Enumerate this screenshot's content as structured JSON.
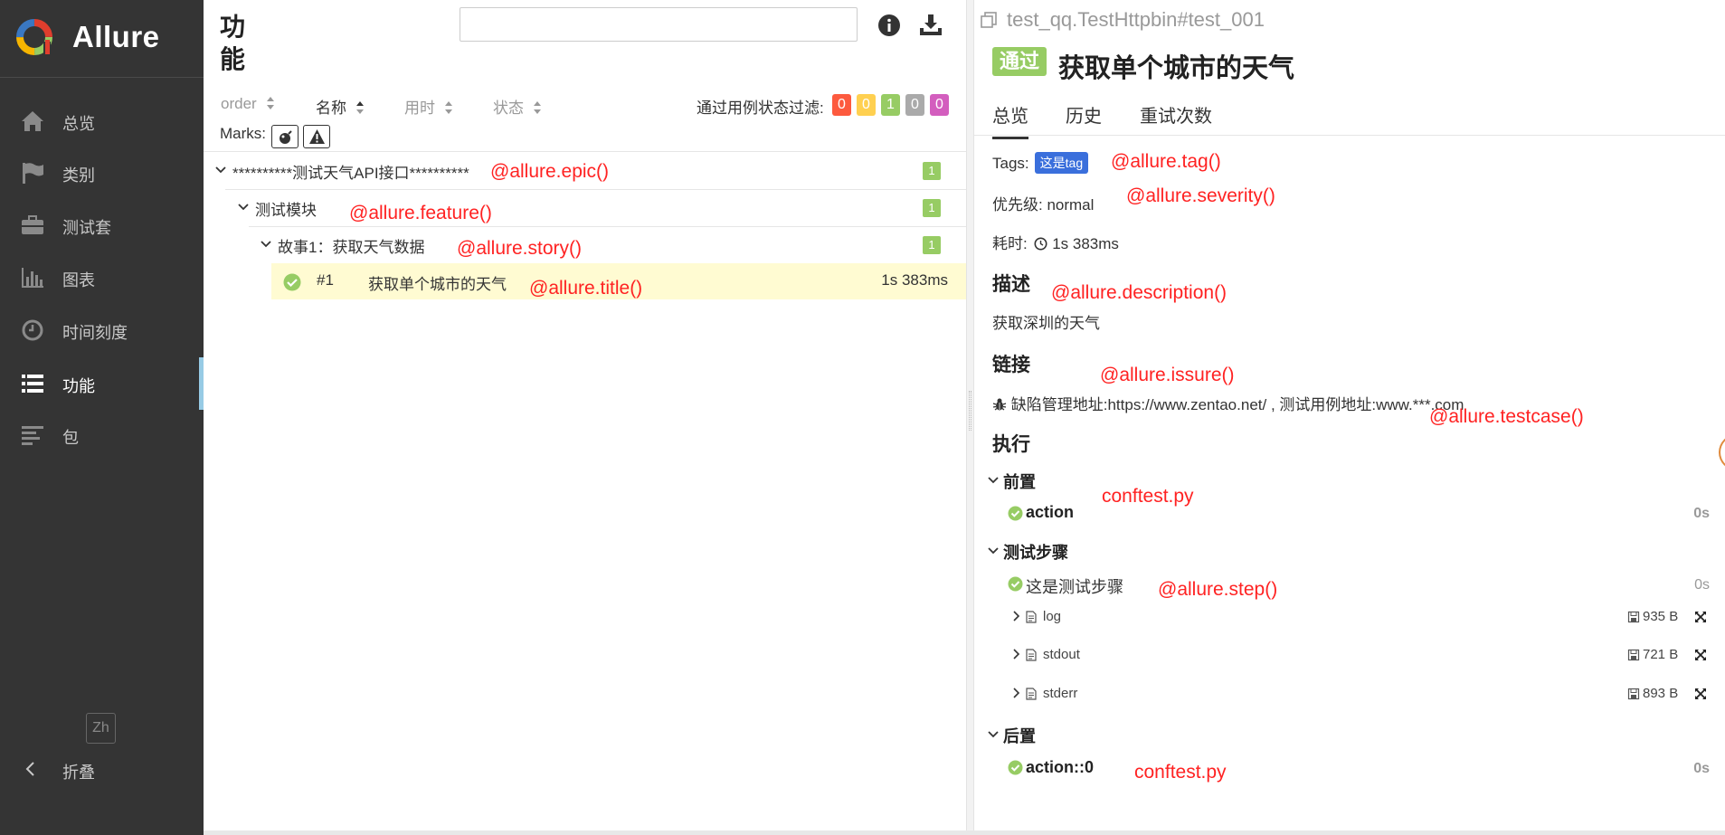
{
  "app": {
    "name": "Allure",
    "logo_colors": [
      "#e03e2d",
      "#f7b500",
      "#97cc64",
      "#3a78c2"
    ]
  },
  "sidebar": {
    "items": [
      {
        "label": "总览",
        "icon": "home-icon"
      },
      {
        "label": "类别",
        "icon": "flag-icon"
      },
      {
        "label": "测试套",
        "icon": "briefcase-icon"
      },
      {
        "label": "图表",
        "icon": "bar-chart-icon"
      },
      {
        "label": "时间刻度",
        "icon": "clock-icon"
      },
      {
        "label": "功能",
        "icon": "list-icon",
        "active": true
      },
      {
        "label": "包",
        "icon": "align-left-icon"
      }
    ],
    "language": "Zh",
    "collapse_label": "折叠"
  },
  "middle": {
    "title": "功能",
    "search_value": "",
    "sort_columns": [
      {
        "label": "order",
        "active": false
      },
      {
        "label": "名称",
        "active": true
      },
      {
        "label": "用时",
        "active": false
      },
      {
        "label": "状态",
        "active": false
      }
    ],
    "filter_label": "通过用例状态过滤:",
    "status_counts": [
      {
        "value": "0",
        "color": "#fd5a3e"
      },
      {
        "value": "0",
        "color": "#ffd050"
      },
      {
        "value": "1",
        "color": "#97cc64"
      },
      {
        "value": "0",
        "color": "#aaaaaa"
      },
      {
        "value": "0",
        "color": "#d35ebe"
      }
    ],
    "marks_label": "Marks:",
    "tree": {
      "epic": {
        "label": "**********测试天气API接口**********",
        "count": "1"
      },
      "feature": {
        "label": "测试模块",
        "count": "1"
      },
      "story": {
        "label": "故事1：获取天气数据",
        "count": "1"
      },
      "test": {
        "order": "#1",
        "label": "获取单个城市的天气",
        "duration": "1s 383ms"
      }
    },
    "annotations": {
      "epic": "@allure.epic()",
      "feature": "@allure.feature()",
      "story": "@allure.story()",
      "title": "@allure.title()"
    }
  },
  "detail": {
    "path": "test_qq.TestHttpbin#test_001",
    "status": "通过",
    "title": "获取单个城市的天气",
    "tabs": [
      "总览",
      "历史",
      "重试次数"
    ],
    "tags_label": "Tags:",
    "tag": "这是tag",
    "severity_label": "优先级: normal",
    "duration_label": "耗时:",
    "duration": "1s 383ms",
    "description_heading": "描述",
    "description": "获取深圳的天气",
    "links_heading": "链接",
    "links_text": "缺陷管理地址:https://www.zentao.net/ , 测试用例地址:www.***.com",
    "execution_heading": "执行",
    "setup_heading": "前置",
    "setup_step": {
      "name": "action",
      "duration": "0s"
    },
    "steps_heading": "测试步骤",
    "step": {
      "name": "这是测试步骤",
      "duration": "0s"
    },
    "attachments": [
      {
        "name": "log",
        "size": "935 B"
      },
      {
        "name": "stdout",
        "size": "721 B"
      },
      {
        "name": "stderr",
        "size": "893 B"
      }
    ],
    "teardown_heading": "后置",
    "teardown_step": {
      "name": "action::0",
      "duration": "0s"
    },
    "annotations": {
      "tag": "@allure.tag()",
      "severity": "@allure.severity()",
      "description": "@allure.description()",
      "issue": "@allure.issure()",
      "testcase": "@allure.testcase()",
      "setup": "conftest.py",
      "step": "@allure.step()",
      "teardown": "conftest.py"
    }
  }
}
